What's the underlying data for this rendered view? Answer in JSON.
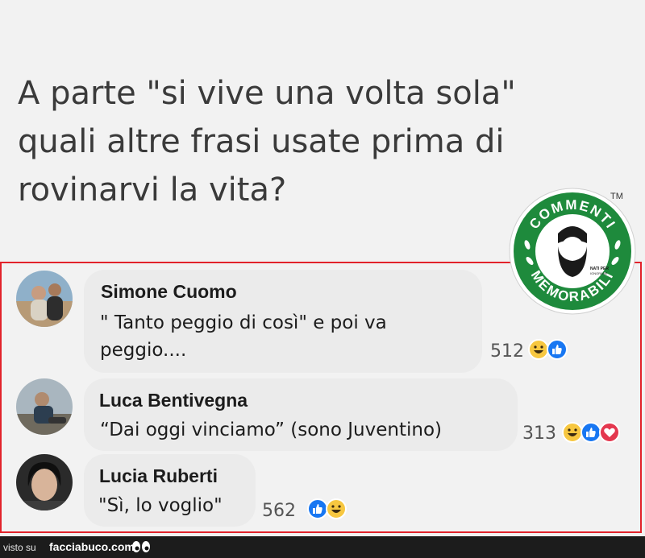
{
  "headline": {
    "line1": "A parte \"si vive una volta sola\"",
    "line2": "quali altre frasi usate prima di",
    "line3": "rovinarvi la vita?"
  },
  "logo": {
    "top_text": "COMMENTI",
    "bottom_text": "MEMORABILI",
    "small_text": "NATI PER IGNORARE",
    "trademark": "TM",
    "colors": {
      "green": "#1e8a3c",
      "ring": "#ffffff"
    }
  },
  "comments": [
    {
      "author": "Simone Cuomo",
      "line1": "\" Tanto peggio di così\" e poi va",
      "line2": "peggio....",
      "count": "512",
      "reactions": [
        "haha-icon",
        "like-icon"
      ]
    },
    {
      "author": "Luca Bentivegna",
      "line1": "“Dai oggi vinciamo” (sono Juventino)",
      "count": "313",
      "reactions": [
        "haha-icon",
        "like-icon",
        "love-icon"
      ]
    },
    {
      "author": "Lucia Ruberti",
      "line1": "\"Sì, lo voglio\"",
      "count": "562",
      "reactions": [
        "like-icon",
        "haha-icon"
      ]
    }
  ],
  "footer": {
    "visto": "visto su",
    "site": "facciabuco.com"
  },
  "colors": {
    "frame": "#e2232b",
    "bubble": "#ebebeb",
    "like": "#1877f2",
    "haha": "#f7c740",
    "love": "#e4384f"
  }
}
